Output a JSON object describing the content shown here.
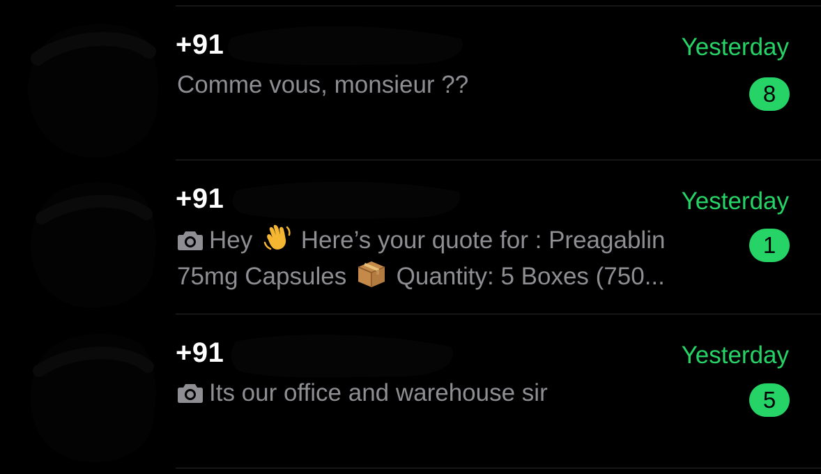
{
  "theme": {
    "background": "#000000",
    "accent": "#25d366",
    "preview_text": "#8e8e93",
    "name_text": "#ffffff",
    "divider": "#2a2a2c"
  },
  "chats": [
    {
      "name": "+91",
      "timestamp": "Yesterday",
      "unread_count": "8",
      "preview": "Comme vous, monsieur ??",
      "has_photo_icon": false
    },
    {
      "name": "+91",
      "timestamp": "Yesterday",
      "unread_count": "1",
      "preview_line1_a": "Hey",
      "preview_line1_b": "Here’s your quote for : Preagablin",
      "preview_line2_a": "75mg Capsules",
      "preview_line2_b": "Quantity: 5 Boxes (750...",
      "emoji_1": "waving-hand-icon",
      "emoji_2": "package-box-icon",
      "has_photo_icon": true
    },
    {
      "name": "+91",
      "timestamp": "Yesterday",
      "unread_count": "5",
      "preview": "Its our office and warehouse sir",
      "has_photo_icon": true
    }
  ],
  "icons": {
    "photo": "camera-icon",
    "avatar": "redacted-avatar"
  }
}
